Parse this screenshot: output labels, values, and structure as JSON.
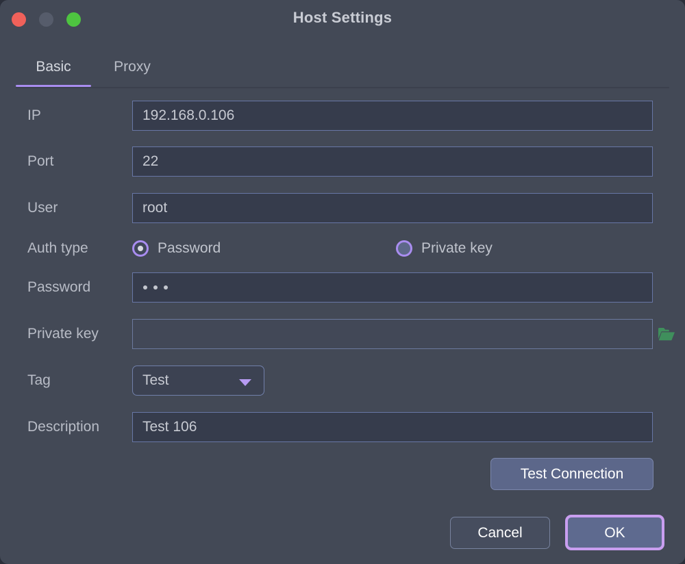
{
  "window": {
    "title": "Host Settings",
    "traffic_lights": [
      {
        "name": "close",
        "color": "#f0615a"
      },
      {
        "name": "minimize",
        "color": "#565c6b"
      },
      {
        "name": "maximize",
        "color": "#4ec440"
      }
    ]
  },
  "tabs": [
    {
      "id": "basic",
      "label": "Basic",
      "active": true
    },
    {
      "id": "proxy",
      "label": "Proxy",
      "active": false
    }
  ],
  "form": {
    "ip": {
      "label": "IP",
      "value": "192.168.0.106"
    },
    "port": {
      "label": "Port",
      "value": "22"
    },
    "user": {
      "label": "User",
      "value": "root"
    },
    "auth_type": {
      "label": "Auth type",
      "options": [
        {
          "id": "password",
          "label": "Password",
          "selected": true
        },
        {
          "id": "private-key",
          "label": "Private key",
          "selected": false
        }
      ]
    },
    "password": {
      "label": "Password",
      "value": "•••",
      "masked_char_count": 3
    },
    "private_key": {
      "label": "Private key",
      "value": "",
      "browse_icon": "folder-open-icon",
      "browse_icon_color": "#3f8f5c"
    },
    "tag": {
      "label": "Tag",
      "value": "Test",
      "caret_icon": "chevron-down-icon"
    },
    "description": {
      "label": "Description",
      "value": "Test 106"
    }
  },
  "buttons": {
    "test_connection": "Test Connection",
    "cancel": "Cancel",
    "ok": "OK"
  },
  "colors": {
    "dialog_bg": "#434956",
    "input_bg": "#363c4c",
    "input_border": "#6877a6",
    "accent_purple": "#a98df0",
    "focus_ring": "#c99ef0",
    "text": "#c7cad2"
  }
}
